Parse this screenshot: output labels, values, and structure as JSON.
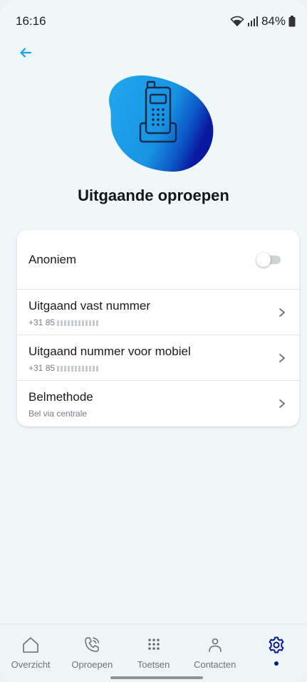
{
  "status": {
    "time": "16:16",
    "battery": "84%"
  },
  "page": {
    "title": "Uitgaande oproepen"
  },
  "settings": [
    {
      "label": "Anoniem",
      "toggle_on": false
    },
    {
      "label": "Uitgaand vast nummer",
      "sub": "+31 85"
    },
    {
      "label": "Uitgaand nummer voor mobiel",
      "sub": "+31 85"
    },
    {
      "label": "Belmethode",
      "sub": "Bel via centrale"
    }
  ],
  "nav": [
    {
      "label": "Overzicht",
      "icon": "home-icon"
    },
    {
      "label": "Oproepen",
      "icon": "phone-calls-icon"
    },
    {
      "label": "Toetsen",
      "icon": "keypad-icon"
    },
    {
      "label": "Contacten",
      "icon": "person-icon"
    },
    {
      "label": "",
      "icon": "gear-icon",
      "active": true
    }
  ],
  "colors": {
    "accent": "#1aa3e8",
    "active": "#0a1a8c",
    "background": "#eff7f8"
  }
}
